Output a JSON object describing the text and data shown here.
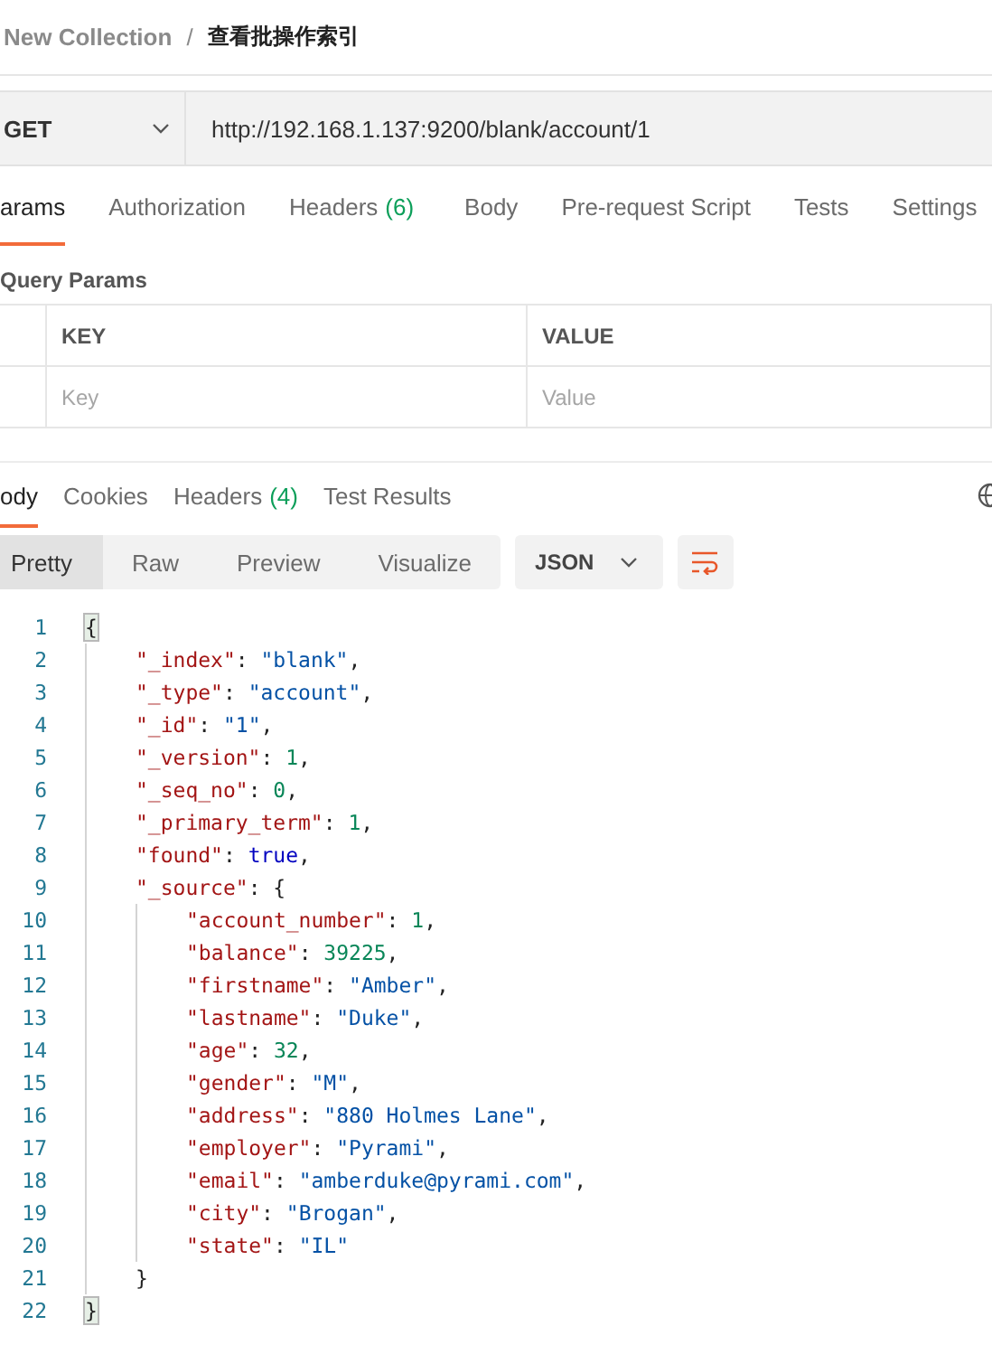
{
  "breadcrumb": {
    "collection": "New Collection",
    "separator": "/",
    "request": "查看批操作索引"
  },
  "request": {
    "method": "GET",
    "url": "http://192.168.1.137:9200/blank/account/1"
  },
  "request_tabs": [
    {
      "label": "arams",
      "selected": true
    },
    {
      "label": "Authorization",
      "selected": false
    },
    {
      "label": "Headers",
      "count": "(6)",
      "selected": false
    },
    {
      "label": "Body",
      "selected": false
    },
    {
      "label": "Pre-request Script",
      "selected": false
    },
    {
      "label": "Tests",
      "selected": false
    },
    {
      "label": "Settings",
      "selected": false
    }
  ],
  "query_params": {
    "title": "Query Params",
    "columns": [
      "KEY",
      "VALUE"
    ],
    "placeholders": [
      "Key",
      "Value"
    ]
  },
  "response_tabs": [
    {
      "label": "ody",
      "selected": true
    },
    {
      "label": "Cookies",
      "selected": false
    },
    {
      "label": "Headers",
      "count": "(4)",
      "selected": false
    },
    {
      "label": "Test Results",
      "selected": false
    }
  ],
  "view_modes": [
    {
      "label": "Pretty",
      "selected": true
    },
    {
      "label": "Raw",
      "selected": false
    },
    {
      "label": "Preview",
      "selected": false
    },
    {
      "label": "Visualize",
      "selected": false
    }
  ],
  "format": "JSON",
  "code": [
    {
      "number": "1",
      "tokens": [
        {
          "kind": "brace",
          "text": "{",
          "highlighted": true
        }
      ],
      "children": [
        {
          "number": "2",
          "tokens": [
            {
              "kind": "key",
              "text": "\"_index\""
            },
            {
              "kind": "punct",
              "text": ": "
            },
            {
              "kind": "string",
              "text": "\"blank\""
            },
            {
              "kind": "punct",
              "text": ","
            }
          ]
        },
        {
          "number": "3",
          "tokens": [
            {
              "kind": "key",
              "text": "\"_type\""
            },
            {
              "kind": "punct",
              "text": ": "
            },
            {
              "kind": "string",
              "text": "\"account\""
            },
            {
              "kind": "punct",
              "text": ","
            }
          ]
        },
        {
          "number": "4",
          "tokens": [
            {
              "kind": "key",
              "text": "\"_id\""
            },
            {
              "kind": "punct",
              "text": ": "
            },
            {
              "kind": "string",
              "text": "\"1\""
            },
            {
              "kind": "punct",
              "text": ","
            }
          ]
        },
        {
          "number": "5",
          "tokens": [
            {
              "kind": "key",
              "text": "\"_version\""
            },
            {
              "kind": "punct",
              "text": ": "
            },
            {
              "kind": "number",
              "text": "1"
            },
            {
              "kind": "punct",
              "text": ","
            }
          ]
        },
        {
          "number": "6",
          "tokens": [
            {
              "kind": "key",
              "text": "\"_seq_no\""
            },
            {
              "kind": "punct",
              "text": ": "
            },
            {
              "kind": "number",
              "text": "0"
            },
            {
              "kind": "punct",
              "text": ","
            }
          ]
        },
        {
          "number": "7",
          "tokens": [
            {
              "kind": "key",
              "text": "\"_primary_term\""
            },
            {
              "kind": "punct",
              "text": ": "
            },
            {
              "kind": "number",
              "text": "1"
            },
            {
              "kind": "punct",
              "text": ","
            }
          ]
        },
        {
          "number": "8",
          "tokens": [
            {
              "kind": "key",
              "text": "\"found\""
            },
            {
              "kind": "punct",
              "text": ": "
            },
            {
              "kind": "keyword",
              "text": "true"
            },
            {
              "kind": "punct",
              "text": ","
            }
          ]
        },
        {
          "number": "9",
          "tokens": [
            {
              "kind": "key",
              "text": "\"_source\""
            },
            {
              "kind": "punct",
              "text": ": "
            },
            {
              "kind": "brace",
              "text": "{",
              "highlighted": false
            }
          ],
          "children": [
            {
              "number": "10",
              "tokens": [
                {
                  "kind": "key",
                  "text": "\"account_number\""
                },
                {
                  "kind": "punct",
                  "text": ": "
                },
                {
                  "kind": "number",
                  "text": "1"
                },
                {
                  "kind": "punct",
                  "text": ","
                }
              ]
            },
            {
              "number": "11",
              "tokens": [
                {
                  "kind": "key",
                  "text": "\"balance\""
                },
                {
                  "kind": "punct",
                  "text": ": "
                },
                {
                  "kind": "number",
                  "text": "39225"
                },
                {
                  "kind": "punct",
                  "text": ","
                }
              ]
            },
            {
              "number": "12",
              "tokens": [
                {
                  "kind": "key",
                  "text": "\"firstname\""
                },
                {
                  "kind": "punct",
                  "text": ": "
                },
                {
                  "kind": "string",
                  "text": "\"Amber\""
                },
                {
                  "kind": "punct",
                  "text": ","
                }
              ]
            },
            {
              "number": "13",
              "tokens": [
                {
                  "kind": "key",
                  "text": "\"lastname\""
                },
                {
                  "kind": "punct",
                  "text": ": "
                },
                {
                  "kind": "string",
                  "text": "\"Duke\""
                },
                {
                  "kind": "punct",
                  "text": ","
                }
              ]
            },
            {
              "number": "14",
              "tokens": [
                {
                  "kind": "key",
                  "text": "\"age\""
                },
                {
                  "kind": "punct",
                  "text": ": "
                },
                {
                  "kind": "number",
                  "text": "32"
                },
                {
                  "kind": "punct",
                  "text": ","
                }
              ]
            },
            {
              "number": "15",
              "tokens": [
                {
                  "kind": "key",
                  "text": "\"gender\""
                },
                {
                  "kind": "punct",
                  "text": ": "
                },
                {
                  "kind": "string",
                  "text": "\"M\""
                },
                {
                  "kind": "punct",
                  "text": ","
                }
              ]
            },
            {
              "number": "16",
              "tokens": [
                {
                  "kind": "key",
                  "text": "\"address\""
                },
                {
                  "kind": "punct",
                  "text": ": "
                },
                {
                  "kind": "string",
                  "text": "\"880 Holmes Lane\""
                },
                {
                  "kind": "punct",
                  "text": ","
                }
              ]
            },
            {
              "number": "17",
              "tokens": [
                {
                  "kind": "key",
                  "text": "\"employer\""
                },
                {
                  "kind": "punct",
                  "text": ": "
                },
                {
                  "kind": "string",
                  "text": "\"Pyrami\""
                },
                {
                  "kind": "punct",
                  "text": ","
                }
              ]
            },
            {
              "number": "18",
              "tokens": [
                {
                  "kind": "key",
                  "text": "\"email\""
                },
                {
                  "kind": "punct",
                  "text": ": "
                },
                {
                  "kind": "string",
                  "text": "\"amberduke@pyrami.com\""
                },
                {
                  "kind": "punct",
                  "text": ","
                }
              ]
            },
            {
              "number": "19",
              "tokens": [
                {
                  "kind": "key",
                  "text": "\"city\""
                },
                {
                  "kind": "punct",
                  "text": ": "
                },
                {
                  "kind": "string",
                  "text": "\"Brogan\""
                },
                {
                  "kind": "punct",
                  "text": ","
                }
              ]
            },
            {
              "number": "20",
              "tokens": [
                {
                  "kind": "key",
                  "text": "\"state\""
                },
                {
                  "kind": "punct",
                  "text": ": "
                },
                {
                  "kind": "string",
                  "text": "\"IL\""
                }
              ]
            }
          ]
        },
        {
          "number": "21",
          "tokens": [
            {
              "kind": "brace",
              "text": "}",
              "highlighted": false
            }
          ]
        }
      ]
    },
    {
      "number": "22",
      "tokens": [
        {
          "kind": "brace",
          "text": "}",
          "highlighted": true
        }
      ]
    }
  ]
}
